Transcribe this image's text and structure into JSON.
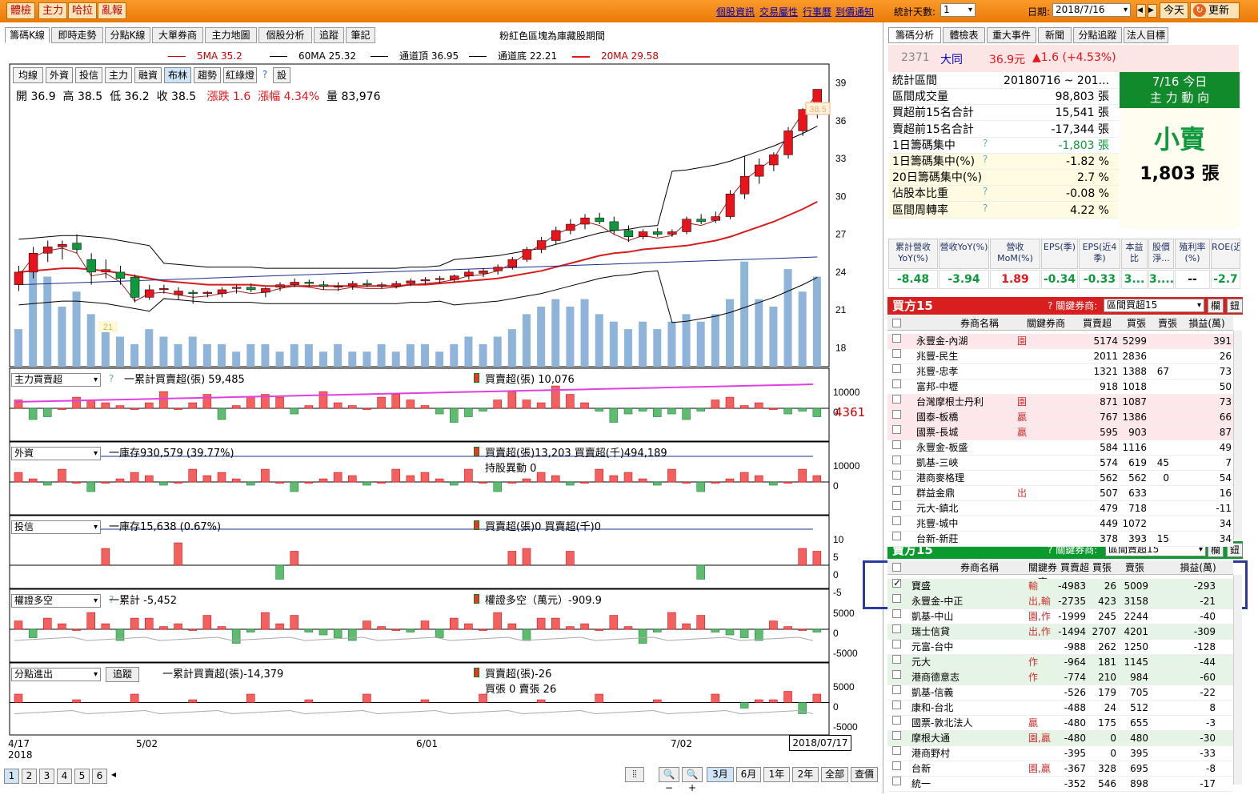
{
  "top": {
    "buttons": [
      "體檢",
      "主力",
      "哈拉",
      "亂報"
    ],
    "links": [
      "個股資訊",
      "交易屬性",
      "行事曆",
      "到價通知"
    ],
    "stat_days_label": "統計天數:",
    "stat_days": "1",
    "date_label": "日期:",
    "date": "2018/7/16",
    "today": "今天",
    "refresh": "更新"
  },
  "left": {
    "tabs": [
      "籌碼K線",
      "即時走勢",
      "分點K線",
      "大單券商",
      "主力地圖",
      "個股分析",
      "追蹤",
      "筆記"
    ],
    "notice": "粉紅色區塊為庫藏股期間",
    "ma_legend": [
      "5MA 35.2",
      "60MA 25.32",
      "通道頂 36.95",
      "通道底 22.21",
      "20MA 29.58"
    ],
    "tools": [
      "均線",
      "外資",
      "投信",
      "主力",
      "融資",
      "布林",
      "趨勢",
      "紅綠燈",
      "?",
      "設"
    ],
    "ohlc": {
      "open": "開 36.9",
      "high": "高 38.5",
      "low": "低 36.2",
      "close": "收 38.5",
      "chg": "漲跌 1.6",
      "pct": "漲幅 4.34%",
      "vol": "量 83,976"
    },
    "price_ticks": [
      "39",
      "36",
      "33",
      "30",
      "27",
      "24",
      "21",
      "18"
    ],
    "last_price": "38.5",
    "low_mark": "21",
    "panels": [
      {
        "sel": "主力買賣超",
        "a": "一累計買賣超(張) 59,485",
        "b": "買賣超(張) 10,076",
        "ticks": [
          "10000",
          "0"
        ],
        "value": "4361"
      },
      {
        "sel": "外資",
        "a": "一庫存930,579 (39.77%)",
        "b": "買賣超(張)13,203 買賣超(千)494,189",
        "c": "持股異動 0",
        "ticks": [
          "10000",
          "0"
        ]
      },
      {
        "sel": "投信",
        "a": "一庫存15,638 (0.67%)",
        "b": "買賣超(張)0 買賣超(千)0",
        "ticks": [
          "10",
          "5",
          "0",
          "-5"
        ]
      },
      {
        "sel": "權證多空",
        "a": "一累計 -5,452",
        "b": "權證多空（萬元）-909.9",
        "ticks": [
          "5000",
          "0",
          "-5000"
        ]
      },
      {
        "sel": "分點進出",
        "btn": "追蹤",
        "a": "一累計買賣超(張)-14,379",
        "b": "買賣超(張)-26",
        "c": "買張 0 賣張 26",
        "ticks": [
          "5000",
          "0",
          "-5000"
        ]
      }
    ],
    "xaxis": [
      "4/17",
      "2018",
      "5/02",
      "6/01",
      "7/02",
      "2018/07/17"
    ],
    "pages": [
      "1",
      "2",
      "3",
      "4",
      "5",
      "6"
    ],
    "ranges": [
      "3月",
      "6月",
      "1年",
      "2年",
      "全部",
      "查價"
    ]
  },
  "right": {
    "tabs": [
      "籌碼分析",
      "體檢表",
      "重大事件",
      "新聞",
      "分點追蹤",
      "法人目標"
    ],
    "stock": {
      "code": "2371",
      "name": "大同",
      "price": "36.9元",
      "chg": "▲1.6 (+4.53%)"
    },
    "stats": [
      [
        "統計區間",
        "20180716 ~ 201..."
      ],
      [
        "區間成交量",
        "98,803 張"
      ],
      [
        "買超前15名合計",
        "15,541 張"
      ],
      [
        "賣超前15名合計",
        "-17,344 張"
      ],
      [
        "1日籌碼集中",
        "-1,803 張"
      ],
      [
        "1日籌碼集中(%)",
        "-1.82 %"
      ],
      [
        "20日籌碼集中(%)",
        "2.7 %"
      ],
      [
        "佔股本比重",
        "-0.08 %"
      ],
      [
        "區間周轉率",
        "4.22 %"
      ]
    ],
    "today_box": {
      "title": "7/16 今日",
      "sub": "主 力 動 向",
      "action": "小賣",
      "amount": "1,803 張"
    },
    "metrics_hdr": [
      "累計營收YoY(%)",
      "營收YoY(%)",
      "營收MoM(%)",
      "EPS(季)",
      "EPS(近4季)",
      "本益比",
      "股價淨...",
      "殖利率(%)",
      "ROE(近..."
    ],
    "metrics": [
      "-8.48",
      "-3.94",
      "1.89",
      "-0.34",
      "-0.33",
      "3...",
      "3....",
      "--",
      "-2.7"
    ],
    "buy15": {
      "title": "買方15",
      "key_label": "關鍵券商:",
      "sel": "區間買超15",
      "btn1": "欄",
      "btn2": "鈕",
      "cols": [
        "券商名稱",
        "關鍵券商",
        "買賣超",
        "買張",
        "賣張",
        "損益(萬)"
      ],
      "rows": [
        [
          "永豐金-內湖",
          "園",
          "5174",
          "5299",
          "",
          "391"
        ],
        [
          "兆豐-民生",
          "",
          "2011",
          "2836",
          "",
          "26"
        ],
        [
          "兆豐-忠孝",
          "",
          "1321",
          "1388",
          "67",
          "73"
        ],
        [
          "富邦-中壢",
          "",
          "918",
          "1018",
          "",
          "50"
        ],
        [
          "台灣摩根士丹利",
          "園",
          "871",
          "1087",
          "",
          "73"
        ],
        [
          "國泰-板橋",
          "贏",
          "767",
          "1386",
          "",
          "66"
        ],
        [
          "國票-長城",
          "贏",
          "595",
          "903",
          "",
          "87"
        ],
        [
          "永豐金-板盛",
          "",
          "584",
          "1116",
          "",
          "49"
        ],
        [
          "凱基-三峽",
          "",
          "574",
          "619",
          "45",
          "7"
        ],
        [
          "港商麥格理",
          "",
          "562",
          "562",
          "0",
          "54"
        ],
        [
          "群益金鼎",
          "出",
          "507",
          "633",
          "",
          "16"
        ],
        [
          "元大-鎮北",
          "",
          "479",
          "718",
          "",
          "-11"
        ],
        [
          "兆豐-城中",
          "",
          "449",
          "1072",
          "",
          "34"
        ],
        [
          "台新-新莊",
          "",
          "378",
          "393",
          "15",
          "34"
        ]
      ]
    },
    "sell15": {
      "title": "賣方15",
      "key_label": "關鍵券商:",
      "sel": "區間賣超15",
      "btn1": "欄",
      "btn2": "鈕",
      "cols": [
        "券商名稱",
        "關鍵券商",
        "買賣超",
        "買張",
        "賣張",
        "損益(萬)"
      ],
      "rows": [
        [
          "寶盛",
          "輸",
          "-4983",
          "26",
          "5009",
          "-293"
        ],
        [
          "永豐金-中正",
          "出,輸",
          "-2735",
          "423",
          "3158",
          "-21"
        ],
        [
          "凱基-中山",
          "園,作",
          "-1999",
          "245",
          "2244",
          "-40"
        ],
        [
          "瑞士信貸",
          "出,作",
          "-1494",
          "2707",
          "4201",
          "-309"
        ],
        [
          "元富-台中",
          "",
          "-988",
          "262",
          "1250",
          "-128"
        ],
        [
          "元大",
          "作",
          "-964",
          "181",
          "1145",
          "-44"
        ],
        [
          "港商德意志",
          "作",
          "-774",
          "210",
          "984",
          "-60"
        ],
        [
          "凱基-信義",
          "",
          "-526",
          "179",
          "705",
          "-22"
        ],
        [
          "康和-台北",
          "",
          "-488",
          "24",
          "512",
          "8"
        ],
        [
          "國票-敦北法人",
          "贏",
          "-480",
          "175",
          "655",
          "-3"
        ],
        [
          "摩根大通",
          "園,贏",
          "-480",
          "0",
          "480",
          "-30"
        ],
        [
          "港商野村",
          "",
          "-395",
          "0",
          "395",
          "-33"
        ],
        [
          "台新",
          "園,贏",
          "-367",
          "328",
          "695",
          "-8"
        ],
        [
          "統一",
          "",
          "-352",
          "546",
          "898",
          "-17"
        ]
      ]
    }
  },
  "colors": {
    "up": "#e8141c",
    "down": "#0e9a3c",
    "vol": "#8fb4d9",
    "orange": "#ef8a14",
    "blue_hl": "#2c3aa0"
  },
  "chart_data": {
    "type": "candlestick",
    "title": "",
    "xlabel": "",
    "ylabel": "",
    "ylim": [
      16.5,
      40.5
    ],
    "candles": [
      [
        23,
        24.5,
        22.5,
        24
      ],
      [
        24,
        26,
        23.5,
        25.5
      ],
      [
        25.5,
        26.5,
        24.8,
        26
      ],
      [
        26,
        26.5,
        25,
        26.2
      ],
      [
        26.3,
        27,
        25.5,
        25.8
      ],
      [
        25,
        25.5,
        23,
        24
      ],
      [
        24,
        25,
        23.5,
        24.2
      ],
      [
        24,
        24.5,
        23,
        23.5
      ],
      [
        23.6,
        23.8,
        21.6,
        22
      ],
      [
        22,
        23,
        21.8,
        22.6
      ],
      [
        22.6,
        23,
        22.3,
        22.7
      ],
      [
        22.2,
        22.8,
        21.8,
        22.5
      ],
      [
        22.4,
        22.6,
        21.5,
        22.3
      ],
      [
        22.3,
        22.5,
        22,
        22.4
      ],
      [
        22.3,
        22.8,
        22,
        22.6
      ],
      [
        22.7,
        23,
        22.3,
        22.8
      ],
      [
        22.8,
        23.1,
        22.4,
        22.6
      ],
      [
        22.4,
        22.8,
        22,
        22.7
      ],
      [
        22.8,
        23.2,
        22.5,
        23
      ],
      [
        23,
        23.5,
        22.8,
        23.2
      ],
      [
        23.2,
        23.4,
        22.8,
        23.1
      ],
      [
        23,
        23.3,
        22.6,
        22.9
      ],
      [
        22.8,
        23.2,
        22.5,
        22.9
      ],
      [
        22.9,
        23.3,
        22.6,
        23.1
      ],
      [
        23.1,
        23.4,
        22.8,
        23
      ],
      [
        23,
        23.2,
        22.7,
        23
      ],
      [
        22.9,
        23.3,
        22.7,
        23.1
      ],
      [
        23.1,
        23.5,
        22.9,
        23.3
      ],
      [
        23.3,
        23.6,
        23,
        23.4
      ],
      [
        23.4,
        23.7,
        23.1,
        23.5
      ],
      [
        23.4,
        23.8,
        23.2,
        23.7
      ],
      [
        23.7,
        24.2,
        23.4,
        24
      ],
      [
        23.9,
        24.3,
        23.6,
        24.1
      ],
      [
        24.1,
        24.6,
        23.8,
        24.4
      ],
      [
        24.4,
        25.2,
        24.2,
        25
      ],
      [
        25,
        26,
        24.8,
        25.8
      ],
      [
        25.8,
        26.8,
        25.5,
        26.5
      ],
      [
        26.5,
        27.6,
        26.2,
        27.3
      ],
      [
        27.3,
        28.2,
        27,
        27.8
      ],
      [
        27.8,
        28.6,
        27.4,
        28.3
      ],
      [
        28.3,
        28.7,
        27.8,
        28
      ],
      [
        28,
        28.4,
        27,
        27.3
      ],
      [
        27.3,
        27.7,
        26.4,
        26.8
      ],
      [
        26.8,
        27.4,
        26.6,
        27.2
      ],
      [
        27.2,
        27.5,
        26.8,
        27
      ],
      [
        27,
        27.4,
        26.8,
        27.2
      ],
      [
        27.2,
        28.4,
        27,
        28.2
      ],
      [
        28.2,
        28.6,
        27.8,
        28
      ],
      [
        28.1,
        28.8,
        27.9,
        28.4
      ],
      [
        28.4,
        30.5,
        28.2,
        30.2
      ],
      [
        30.2,
        33.2,
        29.8,
        31.6
      ],
      [
        31.6,
        33,
        31,
        32.5
      ],
      [
        32.5,
        33.5,
        32,
        33.3
      ],
      [
        33.3,
        35.5,
        33,
        35.2
      ],
      [
        35.2,
        37,
        34.8,
        36.9
      ],
      [
        36.9,
        38.5,
        36.2,
        38.5
      ]
    ],
    "ma20": [
      24,
      24.1,
      24.2,
      24.3,
      24.3,
      24.2,
      24.1,
      23.9,
      23.7,
      23.5,
      23.3,
      23.2,
      23.1,
      23,
      23,
      23,
      23,
      22.9,
      22.9,
      22.9,
      22.9,
      22.9,
      22.9,
      22.9,
      22.9,
      22.9,
      22.9,
      23,
      23,
      23.1,
      23.2,
      23.3,
      23.4,
      23.5,
      23.7,
      23.9,
      24.1,
      24.4,
      24.7,
      25,
      25.3,
      25.5,
      25.6,
      25.8,
      25.9,
      26,
      26.1,
      26.3,
      26.5,
      26.8,
      27.2,
      27.6,
      28,
      28.5,
      29,
      29.58
    ],
    "vol": [
      5,
      15,
      12,
      8,
      10,
      7,
      6,
      4,
      3,
      5,
      4,
      3,
      4,
      3,
      3,
      2,
      3,
      3,
      2,
      3,
      3,
      2,
      3,
      2,
      2,
      3,
      2,
      3,
      3,
      2,
      3,
      4,
      3,
      4,
      5,
      7,
      8,
      9,
      8,
      9,
      7,
      6,
      5,
      6,
      5,
      6,
      7,
      6,
      7,
      9,
      14,
      9,
      8,
      13,
      10,
      12
    ]
  }
}
